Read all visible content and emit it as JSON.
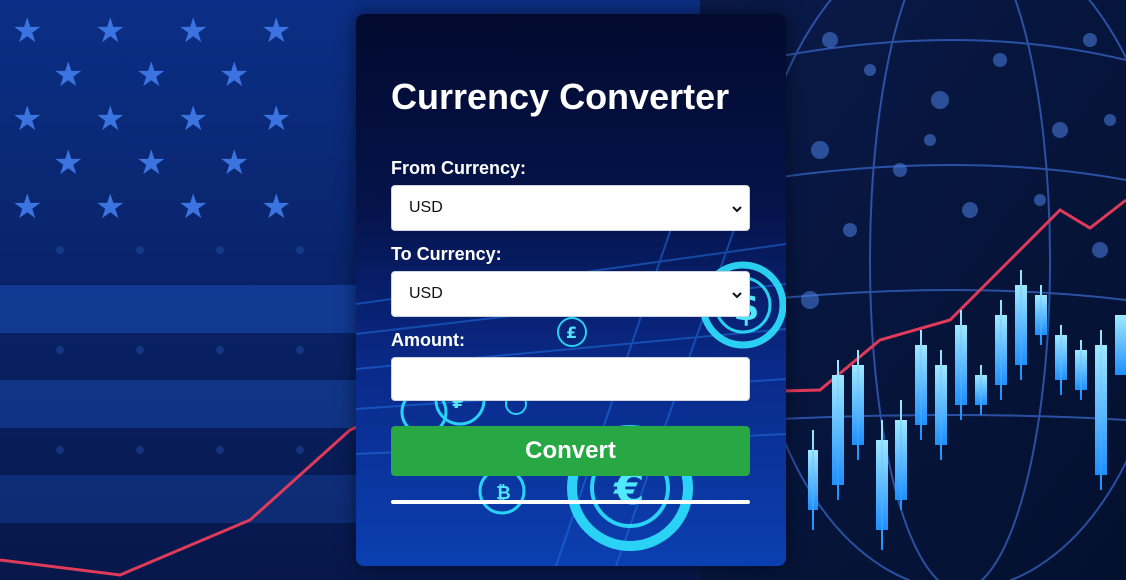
{
  "app": {
    "title": "Currency Converter"
  },
  "form": {
    "from_label": "From Currency:",
    "from_value": "USD",
    "to_label": "To Currency:",
    "to_value": "USD",
    "amount_label": "Amount:",
    "amount_value": "",
    "convert_label": "Convert",
    "result_text": ""
  },
  "colors": {
    "accent": "#28a745",
    "card_top": "#020a2e",
    "card_bottom": "#0b3fb0",
    "page_bg": "#071a4a"
  },
  "icons": {
    "select_arrow": "chevron-down-icon"
  }
}
